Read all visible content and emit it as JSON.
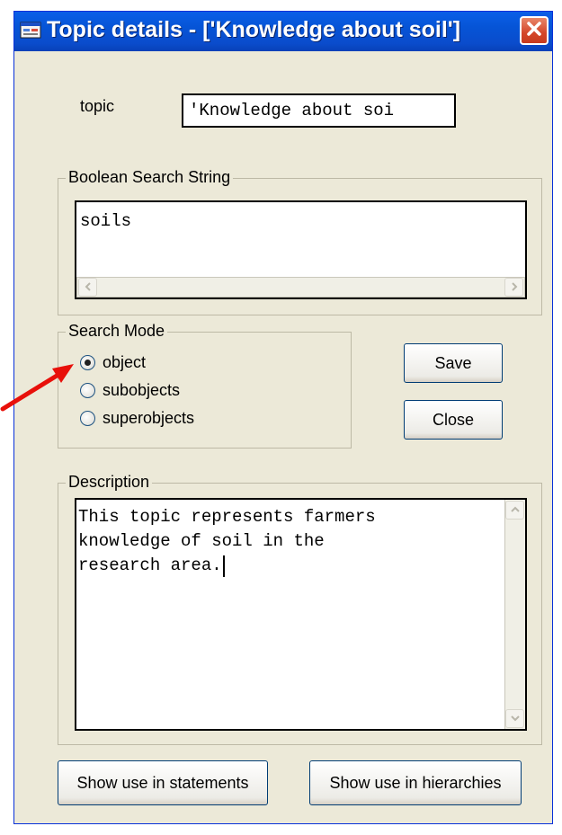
{
  "window": {
    "title": "Topic details - ['Knowledge about soil']"
  },
  "topic": {
    "label": "topic",
    "value": "'Knowledge about soi"
  },
  "boolean_search": {
    "group_label": "Boolean Search String",
    "value": "soils"
  },
  "search_mode": {
    "group_label": "Search Mode",
    "options": [
      {
        "label": "object",
        "checked": true
      },
      {
        "label": "subobjects",
        "checked": false
      },
      {
        "label": "superobjects",
        "checked": false
      }
    ]
  },
  "buttons": {
    "save": "Save",
    "close": "Close",
    "show_statements": "Show use in statements",
    "show_hierarchies": "Show use in hierarchies"
  },
  "description": {
    "group_label": "Description",
    "lines": [
      "This topic represents farmers",
      "knowledge of soil in the",
      "research area."
    ]
  },
  "colors": {
    "annotation_arrow": "#e8100a",
    "titlebar": "#0654d6",
    "window_bg": "#ece9d8"
  }
}
